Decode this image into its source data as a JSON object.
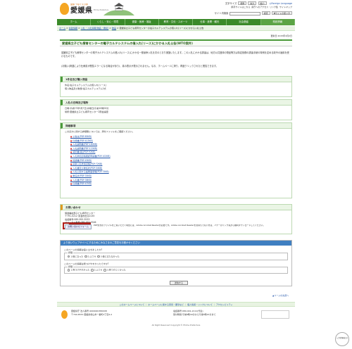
{
  "header": {
    "logo_tagline": "愛顔 つなぐえひめ",
    "logo_name": "愛媛県",
    "logo_english": "Ehime Prefecture",
    "textsize_label": "文字サイズ",
    "textsize_buttons": [
      "標準",
      "拡大",
      "縮小"
    ],
    "lang_link": "Foreign Language",
    "links": [
      "携帯サイトはこちら",
      "県庁へのアクセス",
      "リンク集",
      "サイトマップ"
    ],
    "site_search_label": "サイト内検索",
    "search_btn": "検索",
    "mysite_btn": "▼サイトの使い方"
  },
  "nav": [
    "ホーム",
    "くらし・安心・環境",
    "健康・医療・福祉",
    "教育・文化・スポーツ",
    "仕事・産業・観光",
    "社会基盤",
    "県政情報"
  ],
  "breadcrumb": {
    "items": [
      "ホーム",
      "県政情報",
      "入札・入札情報(物品・委託)",
      "物品"
    ],
    "current": "愛媛県立子ども療育センターの電子カルテシステムの借入れ(リース)にかかる入札公告"
  },
  "main": {
    "updated": "更新日:2015年4月2日",
    "title": "愛媛県立子ども療育センターの電子カルテシステムの借入れ(リース)にかかる入札公告(WTO案件)",
    "intro": "愛媛県立子ども療育センターの電子カルテシステムの借入れ(リース)にかかる一般競争入札を次のとおり実施いたします。この入札にかかる調達は、地方公共団体の物品等又は特定役務の調達手続の特例を定める政令の適用を受けるものです。",
    "note": "(お願い)掲載により仕様書が閲覧エラーになる場合があり(、真の表示が表示されません。なお、ホームページに掲り、再度クリックされたと閲覧できます。",
    "sec1": {
      "heading": "1件名及び購入物品",
      "items": [
        "件名:電子カルテシステムの借入れ(リース)",
        "借入物品及び数量:電子カルテシステム1式"
      ]
    },
    "sec2": {
      "heading": "入札の日時及び場所",
      "items": [
        "日時:平成27年5月7日(木曜日)午前10時00分",
        "場所:愛媛県立子ども療育センター2階会議室"
      ]
    },
    "sec3": {
      "heading": "詳細事項",
      "lead": "このほかに関する詳細等については、添付ファイルをご確認ください。",
      "files": [
        "公告文(PDF:85KB)",
        "仕様書(PDF:413KB)",
        "入札説明書(PDF:180KB)",
        "入札説明書(PDF:120KB)",
        "契約書(案)(PDF:92KB)",
        "入札参加資格確認申請書(PDF:102KB)",
        "質疑書(PDF:45KB)",
        "競争入札参加資格(PDF:72KB)",
        "入札書及び委任状(PDF:34KB)",
        "入札に関する設問事項等(PDF:75KB)",
        "委任状(PDF:35KB)",
        "入札書(PDF:38KB)",
        "仕様書(PDF:47KB)"
      ]
    },
    "acrobat": {
      "banner": "Get Adobe Acrobat Reader",
      "text": "PDF形式のファイルをご覧いただく場合には、Adobe Acrobat Readerが必要です。Adobe Acrobat Readerをお持ちでない方は、バナーのリンク先から無料ダウンロードしてください。"
    },
    "contact": {
      "heading": "お問い合わせ",
      "lines": [
        "保健福祉部子ども療育センター",
        "〒791-0212 東温市田窪2135",
        "電話番号:089-955-5533",
        "ファックス番号:089-955-5546"
      ],
      "form_btn": "お問い合わせフォーム"
    },
    "survey": {
      "heading": "より良いウェブサイトにするためにみなさまのご意見をお聞かせください",
      "q1": "このページの情報は役に立ちましたか?",
      "q1_legend": "評価",
      "q1_opts": [
        "1:役に立った",
        "2:ふつう",
        "3:役に立たなかった"
      ],
      "q2": "このページの情報は見つけやすかったですか?",
      "q2_legend": "評価",
      "q2_opts": [
        "1:見つけやすかった",
        "2:ふつう",
        "3:見つけにくかった"
      ],
      "submit": "送信する"
    }
  },
  "footer": {
    "pagetop": "ページの先頭へ",
    "links": [
      "このホームページについて",
      "ホームページに関する意見・要望など",
      "個人情報・リンクについて",
      "アクセシビリティ"
    ],
    "office": "愛媛県庁 法人番号:4000020380008",
    "address": "〒790-8570 愛媛県松山市一番町4丁目4-2",
    "phone": "電話番号:089-941-2111(代表)",
    "hours": "受付時間:午前8時30分から午後5時15分まで",
    "copyright": "All Right Reserved Copyright © Ehime Prefecture",
    "float_btn": "入力状態(拡大)"
  }
}
